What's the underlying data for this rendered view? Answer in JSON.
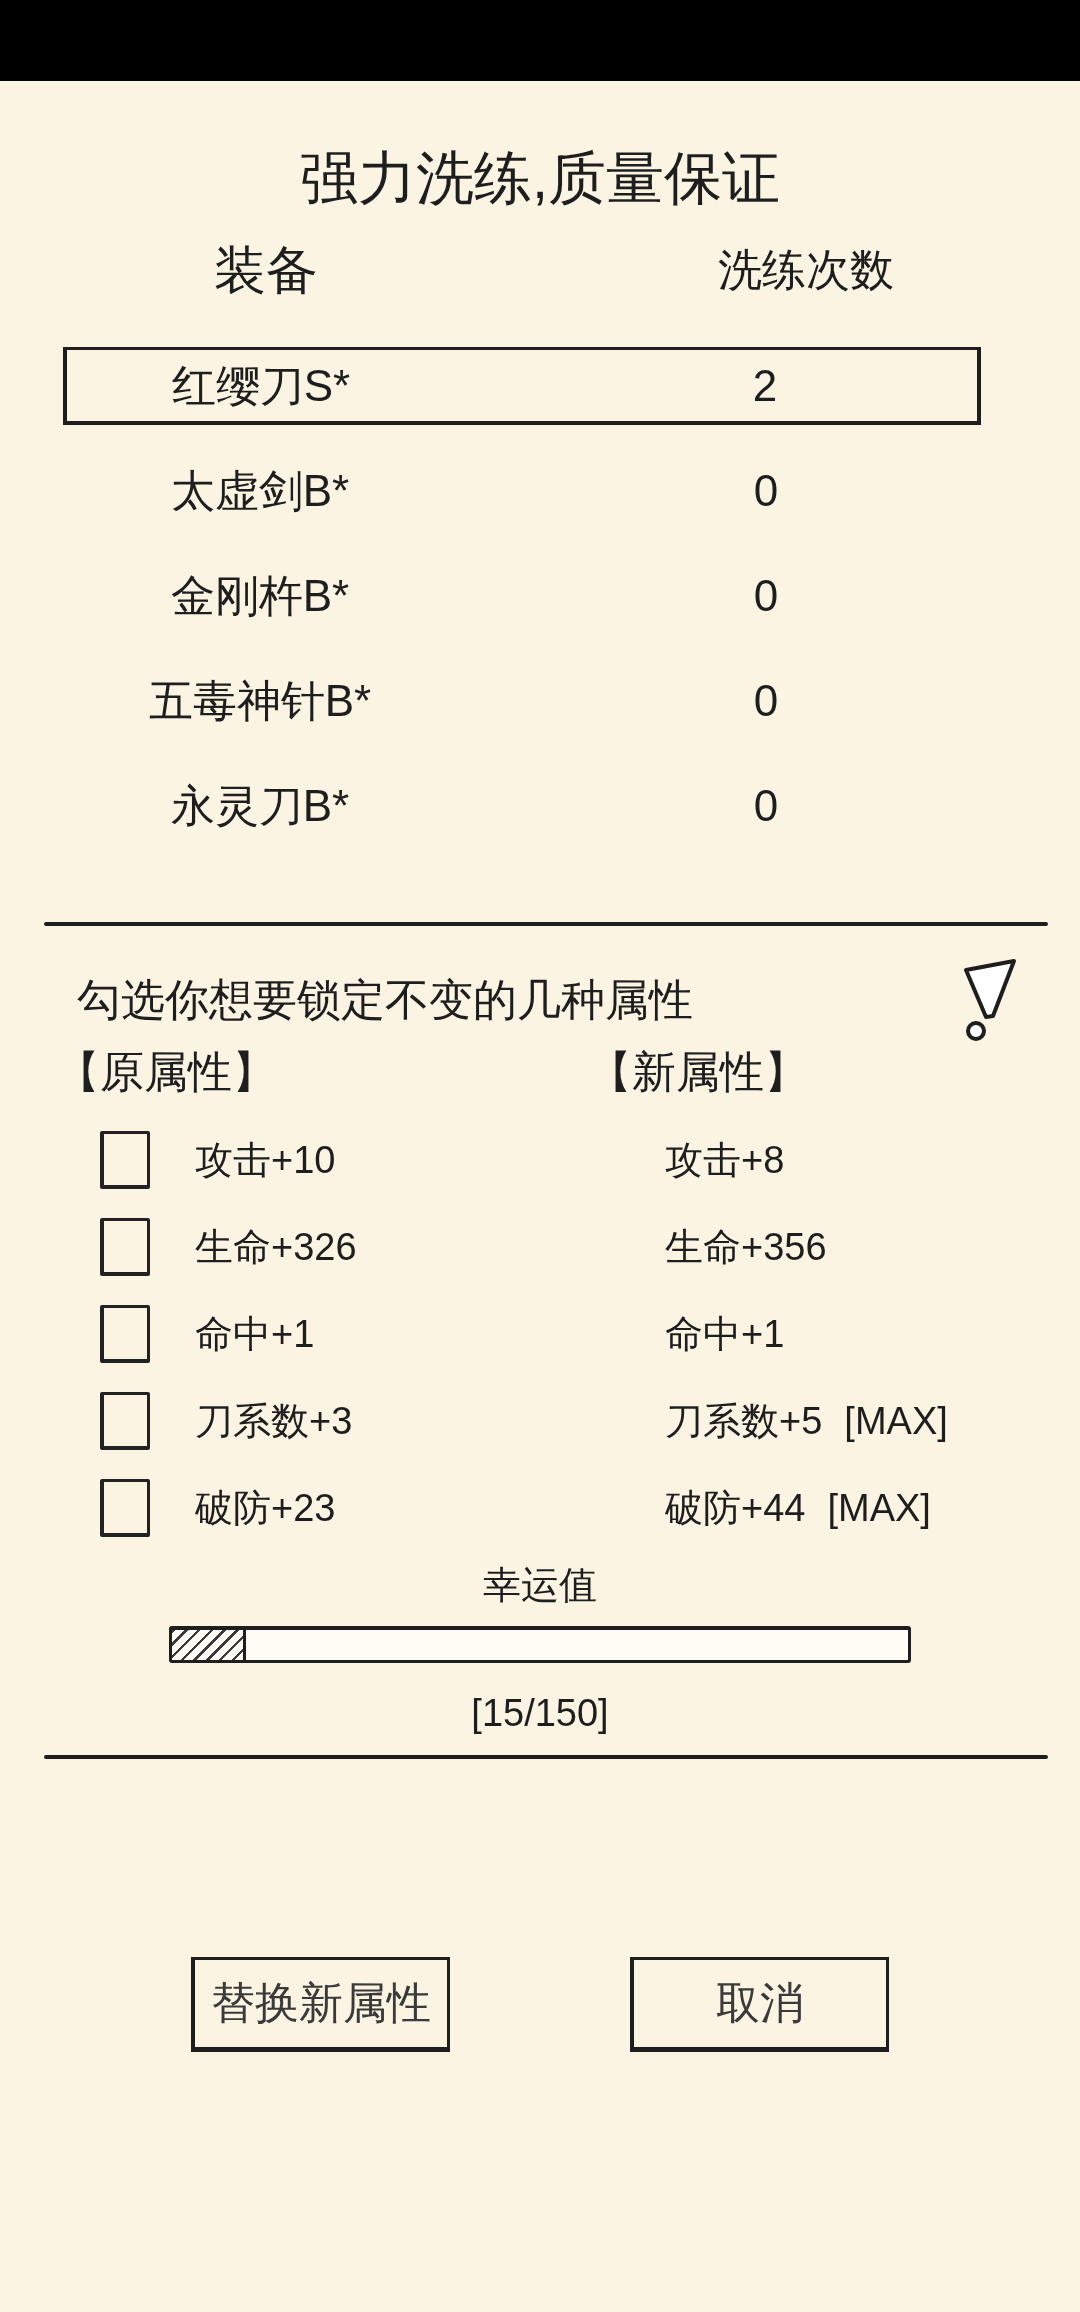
{
  "title": "强力洗练,质量保证",
  "equipment_table": {
    "columns": [
      "装备",
      "洗练次数"
    ],
    "rows": [
      {
        "name": "红缨刀S*",
        "count": "2",
        "selected": true
      },
      {
        "name": "太虚剑B*",
        "count": "0",
        "selected": false
      },
      {
        "name": "金刚杵B*",
        "count": "0",
        "selected": false
      },
      {
        "name": "五毒神针B*",
        "count": "0",
        "selected": false
      },
      {
        "name": "永灵刀B*",
        "count": "0",
        "selected": false
      }
    ]
  },
  "lock_section": {
    "instruction": "勾选你想要锁定不变的几种属性",
    "original_heading": "【原属性】",
    "new_heading": "【新属性】",
    "attributes": [
      {
        "checked": false,
        "original": "攻击+10",
        "new": "攻击+8"
      },
      {
        "checked": false,
        "original": "生命+326",
        "new": "生命+356"
      },
      {
        "checked": false,
        "original": "命中+1",
        "new": "命中+1"
      },
      {
        "checked": false,
        "original": "刀系数+3",
        "new": "刀系数+5",
        "tag": "[MAX]"
      },
      {
        "checked": false,
        "original": "破防+23",
        "new": "破防+44",
        "tag": "[MAX]"
      }
    ]
  },
  "luck": {
    "label": "幸运值",
    "level": 0.1,
    "reading": "[15/150]"
  },
  "buttons": [
    "替换新属性",
    "取消"
  ]
}
